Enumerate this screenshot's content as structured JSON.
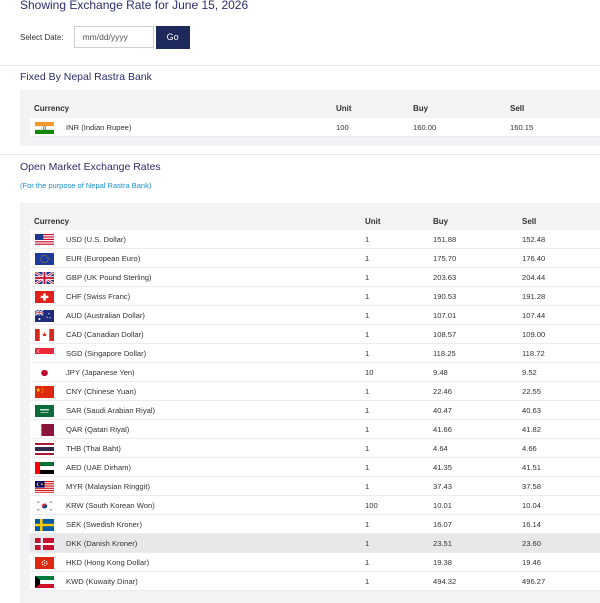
{
  "header": {
    "title": "Showing Exchange Rate for June 15, 2026"
  },
  "date_picker": {
    "label": "Select Date:",
    "placeholder": "mm/dd/yyyy",
    "go_label": "Go"
  },
  "fixed": {
    "title": "Fixed By Nepal Rastra Bank",
    "headers": {
      "currency": "Currency",
      "unit": "Unit",
      "buy": "Buy",
      "sell": "Sell"
    },
    "rows": [
      {
        "flag": "in-flag-icon",
        "name": "INR (Indian Rupee)",
        "unit": "100",
        "buy": "160.00",
        "sell": "160.15"
      }
    ]
  },
  "open_market": {
    "title": "Open Market Exchange Rates",
    "subtitle": "(For the purpose of Nepal Rastra Bank)",
    "headers": {
      "currency": "Currency",
      "unit": "Unit",
      "buy": "Buy",
      "sell": "Sell"
    },
    "rows": [
      {
        "flag": "us-flag-icon",
        "name": "USD (U.S. Dollar)",
        "unit": "1",
        "buy": "151.88",
        "sell": "152.48"
      },
      {
        "flag": "eu-flag-icon",
        "name": "EUR (European Euro)",
        "unit": "1",
        "buy": "175.70",
        "sell": "176.40"
      },
      {
        "flag": "gb-flag-icon",
        "name": "GBP (UK Pound Sterling)",
        "unit": "1",
        "buy": "203.63",
        "sell": "204.44"
      },
      {
        "flag": "ch-flag-icon",
        "name": "CHF (Swiss Franc)",
        "unit": "1",
        "buy": "190.53",
        "sell": "191.28"
      },
      {
        "flag": "au-flag-icon",
        "name": "AUD (Australian Dollar)",
        "unit": "1",
        "buy": "107.01",
        "sell": "107.44"
      },
      {
        "flag": "ca-flag-icon",
        "name": "CAD (Canadian Dollar)",
        "unit": "1",
        "buy": "108.57",
        "sell": "109.00"
      },
      {
        "flag": "sg-flag-icon",
        "name": "SGD (Singapore Dollar)",
        "unit": "1",
        "buy": "118.25",
        "sell": "118.72"
      },
      {
        "flag": "jp-flag-icon",
        "name": "JPY (Japanese Yen)",
        "unit": "10",
        "buy": "9.48",
        "sell": "9.52"
      },
      {
        "flag": "cn-flag-icon",
        "name": "CNY (Chinese Yuan)",
        "unit": "1",
        "buy": "22.46",
        "sell": "22.55"
      },
      {
        "flag": "sa-flag-icon",
        "name": "SAR (Saudi Arabian Riyal)",
        "unit": "1",
        "buy": "40.47",
        "sell": "40.63"
      },
      {
        "flag": "qa-flag-icon",
        "name": "QAR (Qatari Riyal)",
        "unit": "1",
        "buy": "41.66",
        "sell": "41.82"
      },
      {
        "flag": "th-flag-icon",
        "name": "THB (Thai Baht)",
        "unit": "1",
        "buy": "4.64",
        "sell": "4.66"
      },
      {
        "flag": "ae-flag-icon",
        "name": "AED (UAE Dirham)",
        "unit": "1",
        "buy": "41.35",
        "sell": "41.51"
      },
      {
        "flag": "my-flag-icon",
        "name": "MYR (Malaysian Ringgit)",
        "unit": "1",
        "buy": "37.43",
        "sell": "37.58"
      },
      {
        "flag": "kr-flag-icon",
        "name": "KRW (South Korean Won)",
        "unit": "100",
        "buy": "10.01",
        "sell": "10.04"
      },
      {
        "flag": "se-flag-icon",
        "name": "SEK (Swedish Kroner)",
        "unit": "1",
        "buy": "16.07",
        "sell": "16.14"
      },
      {
        "flag": "dk-flag-icon",
        "name": "DKK (Danish Kroner)",
        "unit": "1",
        "buy": "23.51",
        "sell": "23.60",
        "highlighted": true
      },
      {
        "flag": "hk-flag-icon",
        "name": "HKD (Hong Kong Dollar)",
        "unit": "1",
        "buy": "19.38",
        "sell": "19.46"
      },
      {
        "flag": "kw-flag-icon",
        "name": "KWD (Kuwaity Dinar)",
        "unit": "1",
        "buy": "494.32",
        "sell": "496.27"
      }
    ]
  },
  "colors": {
    "accent": "#1f2a5c",
    "title": "#2e2e6e",
    "link": "#1a8fd0",
    "panel": "#f3f3f5",
    "highlight": "#e8e8ea"
  }
}
